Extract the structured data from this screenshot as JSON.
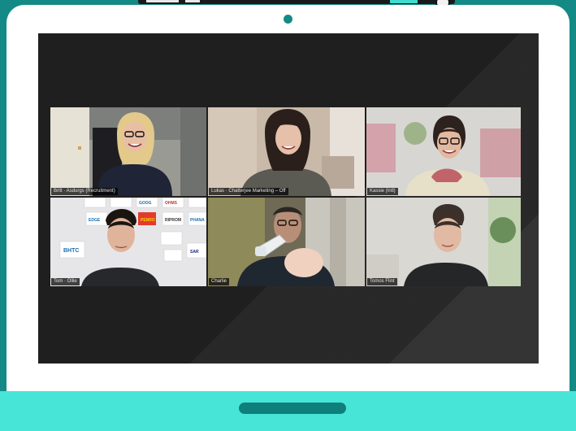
{
  "meeting": {
    "participants": [
      {
        "name": "Britt · Asdurgs (Recruitment)",
        "status": "camera-on"
      },
      {
        "name": "Lukas · Chatterjee Marketing – Off",
        "status": "speaking"
      },
      {
        "name": "Kassie (Intl)",
        "status": "camera-on"
      },
      {
        "name": "Tom · Ollie",
        "status": "camera-on"
      },
      {
        "name": "Charlie",
        "status": "camera-on"
      },
      {
        "name": "Tomos Flint",
        "status": "camera-on"
      }
    ]
  },
  "logo_wall": [
    "OHMS",
    "RIPROM",
    "PENRO",
    "BHTC",
    "SAR",
    "GOOG",
    "PHANA",
    "EDGE"
  ],
  "colors": {
    "desk_background": "#138a86",
    "bezel": "#ffffff",
    "laptop_base": "#47e5d7",
    "screen_background": "#1f1f1f",
    "active_speaker_border": "#d7ea5a"
  }
}
